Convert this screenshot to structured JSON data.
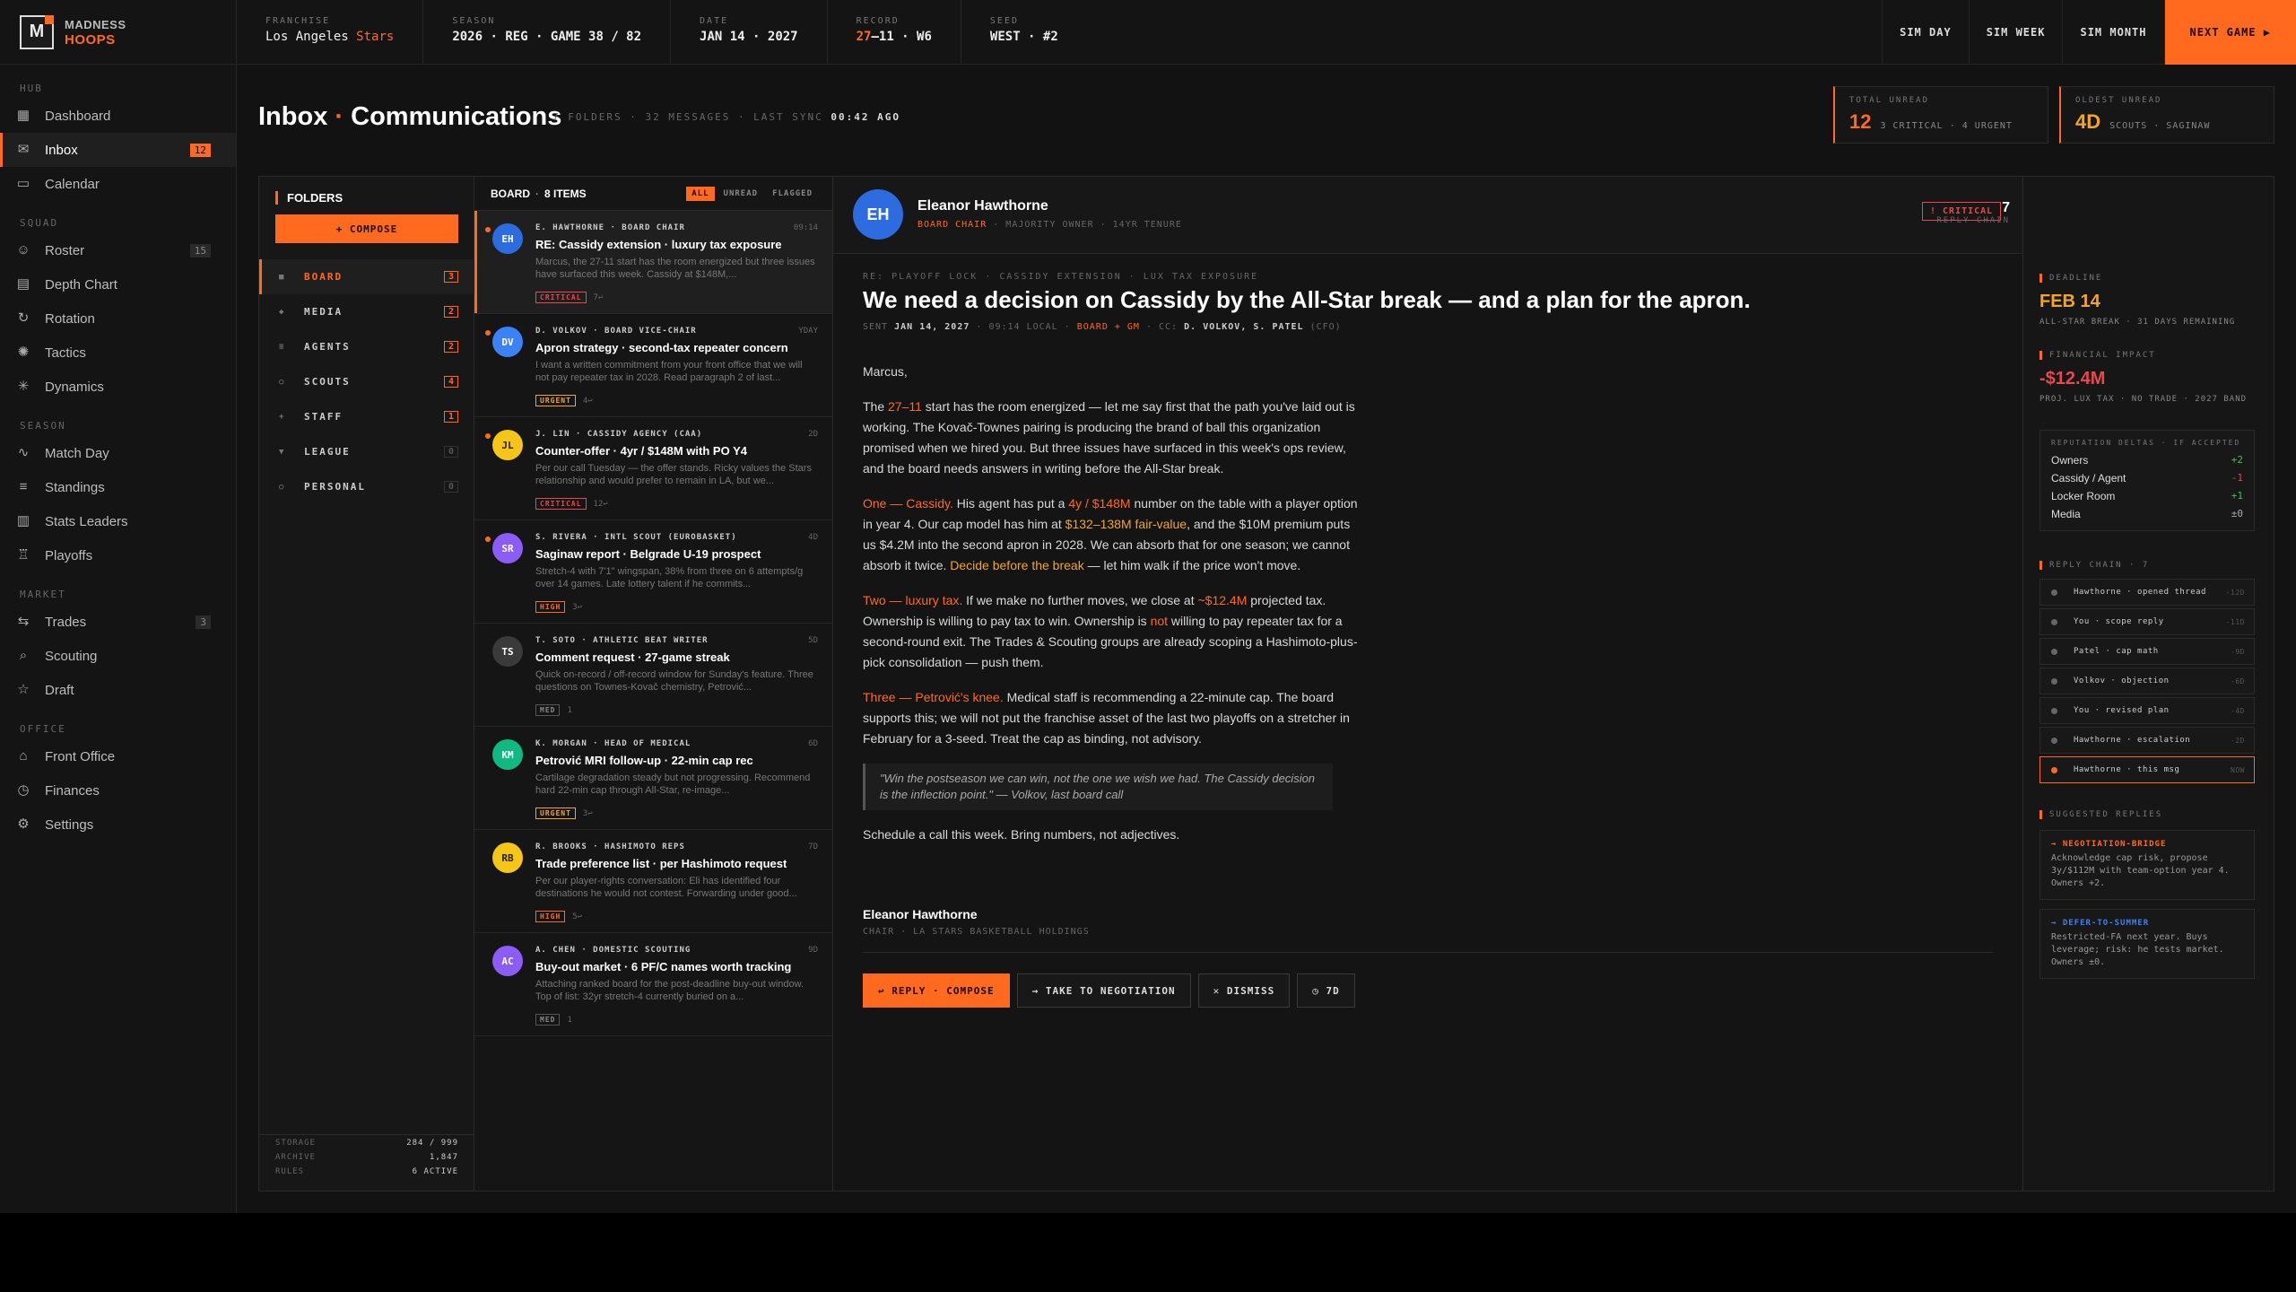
{
  "brand": {
    "line1": "MADNESS",
    "line2": "HOOPS",
    "logo": "M"
  },
  "colors": {
    "accent": "#ff6a1f",
    "warning": "#f5a524",
    "critical": "#e5484d",
    "positive": "#3fbf5f"
  },
  "topbar": {
    "stats": [
      {
        "label": "FRANCHISE",
        "value": "Los Angeles",
        "accent": "Stars"
      },
      {
        "label": "SEASON",
        "value": "2026 · REG · GAME 38 / 82"
      },
      {
        "label": "DATE",
        "value": "JAN 14 · 2027"
      },
      {
        "label": "RECORD",
        "accent": "27",
        "value": "–11 · W6"
      },
      {
        "label": "SEED",
        "value": "WEST · #2"
      }
    ],
    "buttons": [
      "SIM DAY",
      "SIM WEEK",
      "SIM MONTH",
      "NEXT GAME ▶"
    ]
  },
  "sidebar": {
    "sections": [
      {
        "label": "HUB",
        "items": [
          {
            "label": "Dashboard",
            "icon": "grid-icon"
          },
          {
            "label": "Inbox",
            "icon": "mail-icon",
            "count": "12",
            "active": true
          },
          {
            "label": "Calendar",
            "icon": "calendar-icon"
          }
        ]
      },
      {
        "label": "SQUAD",
        "items": [
          {
            "label": "Roster",
            "icon": "user-icon",
            "count": "15"
          },
          {
            "label": "Depth Chart",
            "icon": "layers-icon"
          },
          {
            "label": "Rotation",
            "icon": "rotation-icon"
          },
          {
            "label": "Tactics",
            "icon": "tactics-icon"
          },
          {
            "label": "Dynamics",
            "icon": "dynamics-icon"
          }
        ]
      },
      {
        "label": "SEASON",
        "items": [
          {
            "label": "Match Day",
            "icon": "pulse-icon"
          },
          {
            "label": "Standings",
            "icon": "list-icon"
          },
          {
            "label": "Stats Leaders",
            "icon": "bar-chart-icon"
          },
          {
            "label": "Playoffs",
            "icon": "trophy-icon"
          }
        ]
      },
      {
        "label": "MARKET",
        "items": [
          {
            "label": "Trades",
            "icon": "swap-icon",
            "count": "3"
          },
          {
            "label": "Scouting",
            "icon": "search-icon"
          },
          {
            "label": "Draft",
            "icon": "star-icon"
          }
        ]
      },
      {
        "label": "OFFICE",
        "items": [
          {
            "label": "Front Office",
            "icon": "building-icon"
          },
          {
            "label": "Finances",
            "icon": "clock-icon"
          },
          {
            "label": "Settings",
            "icon": "gear-icon"
          }
        ]
      }
    ]
  },
  "header": {
    "title_a": "Inbox",
    "title_dot": "·",
    "title_b": "Communications",
    "sub": "7 FOLDERS · 32 MESSAGES · LAST SYNC",
    "sync": "00:42 AGO",
    "kpis": [
      {
        "label": "TOTAL UNREAD",
        "value": "12",
        "detail": "3 CRITICAL · 4 URGENT"
      },
      {
        "label": "OLDEST UNREAD",
        "value": "4D",
        "detail": "SCOUTS · SAGINAW"
      }
    ]
  },
  "folders": {
    "title": "FOLDERS",
    "compose": "+ COMPOSE",
    "items": [
      {
        "icon": "■",
        "label": "BOARD",
        "count": "3",
        "active": true
      },
      {
        "icon": "◆",
        "label": "MEDIA",
        "count": "2"
      },
      {
        "icon": "≡",
        "label": "AGENTS",
        "count": "2"
      },
      {
        "icon": "○",
        "label": "SCOUTS",
        "count": "4"
      },
      {
        "icon": "+",
        "label": "STAFF",
        "count": "1"
      },
      {
        "icon": "▼",
        "label": "LEAGUE",
        "count": "0"
      },
      {
        "icon": "○",
        "label": "PERSONAL",
        "count": "0"
      }
    ],
    "stats": [
      {
        "label": "STORAGE",
        "value": "284 / 999"
      },
      {
        "label": "ARCHIVE",
        "value": "1,847"
      },
      {
        "label": "RULES",
        "value": "6 ACTIVE"
      }
    ]
  },
  "list": {
    "folder": "BOARD",
    "count": "8 ITEMS",
    "filters": [
      "ALL",
      "UNREAD",
      "FLAGGED"
    ],
    "messages": [
      {
        "initials": "EH",
        "color": "#2d6cdf",
        "from": "E. HAWTHORNE · BOARD CHAIR",
        "time": "09:14",
        "subject": "RE: Cassidy extension · luxury tax exposure",
        "preview": "Marcus, the 27-11 start has the room energized but three issues have surfaced this week. Cassidy at $148M,...",
        "tag": "CRITICAL",
        "tagType": "crit",
        "replies": "7↩",
        "unread": true,
        "selected": true
      },
      {
        "initials": "DV",
        "color": "#3b82f6",
        "from": "D. VOLKOV · BOARD VICE-CHAIR",
        "time": "YDAY",
        "subject": "Apron strategy · second-tax repeater concern",
        "preview": "I want a written commitment from your front office that we will not pay repeater tax in 2028. Read paragraph 2 of last...",
        "tag": "URGENT",
        "tagType": "urg",
        "replies": "4↩",
        "unread": true
      },
      {
        "initials": "JL",
        "color": "#f5c518",
        "from": "J. LIN · CASSIDY AGENCY (CAA)",
        "time": "2D",
        "subject": "Counter-offer · 4yr / $148M with PO Y4",
        "preview": "Per our call Tuesday — the offer stands. Ricky values the Stars relationship and would prefer to remain in LA, but we...",
        "tag": "CRITICAL",
        "tagType": "crit",
        "replies": "12↩",
        "unread": true
      },
      {
        "initials": "SR",
        "color": "#8b5cf6",
        "from": "S. RIVERA · INTL SCOUT (EUROBASKET)",
        "time": "4D",
        "subject": "Saginaw report · Belgrade U-19 prospect",
        "preview": "Stretch-4 with 7'1\" wingspan, 38% from three on 6 attempts/g over 14 games. Late lottery talent if he commits...",
        "tag": "HIGH",
        "tagType": "high",
        "replies": "3↩",
        "unread": true
      },
      {
        "initials": "TS",
        "color": "#3a3a3a",
        "from": "T. SOTO · ATHLETIC BEAT WRITER",
        "time": "5D",
        "subject": "Comment request · 27-game streak",
        "preview": "Quick on-record / off-record window for Sunday's feature. Three questions on Townes-Kovač chemistry, Petrović...",
        "tag": "MED",
        "tagType": "med",
        "replies": "1"
      },
      {
        "initials": "KM",
        "color": "#10b981",
        "from": "K. MORGAN · HEAD OF MEDICAL",
        "time": "6D",
        "subject": "Petrović MRI follow-up · 22-min cap rec",
        "preview": "Cartilage degradation steady but not progressing. Recommend hard 22-min cap through All-Star, re-image...",
        "tag": "URGENT",
        "tagType": "urg",
        "replies": "3↩"
      },
      {
        "initials": "RB",
        "color": "#f5c518",
        "from": "R. BROOKS · HASHIMOTO REPS",
        "time": "7D",
        "subject": "Trade preference list · per Hashimoto request",
        "preview": "Per our player-rights conversation: Eli has identified four destinations he would not contest. Forwarding under good...",
        "tag": "HIGH",
        "tagType": "high",
        "replies": "5↩"
      },
      {
        "initials": "AC",
        "color": "#8b5cf6",
        "from": "A. CHEN · DOMESTIC SCOUTING",
        "time": "9D",
        "subject": "Buy-out market · 6 PF/C names worth tracking",
        "preview": "Attaching ranked board for the post-deadline buy-out window. Top of list: 32yr stretch-4 currently buried on a...",
        "tag": "MED",
        "tagType": "med",
        "replies": "1"
      }
    ]
  },
  "reader": {
    "initials": "EH",
    "name": "Eleanor Hawthorne",
    "role": "BOARD CHAIR",
    "role_rest": "· MAJORITY OWNER · 14YR TENURE",
    "badge": "! CRITICAL",
    "reply_count": "7",
    "reply_label": "REPLY CHAIN",
    "meta": "RE: PLAYOFF LOCK · CASSIDY EXTENSION · LUX TAX EXPOSURE",
    "subject": "We need a decision on Cassidy by the All-Star break — and a plan for the apron.",
    "sent_label": "SENT",
    "sent_date": "JAN 14, 2027",
    "sent_time": "· 09:14 LOCAL ·",
    "sent_to": "BOARD + GM",
    "cc_label": "· CC:",
    "cc_a": "D. VOLKOV,",
    "cc_b": "S. PATEL",
    "cc_c": "(CFO)",
    "greeting": "Marcus,",
    "p1": {
      "a": "The ",
      "b": "27–11",
      "c": " start has the room energized — let me say first that the path you've laid out is working. The Kovač-Townes pairing is producing the brand of ball this organization promised when we hired you. But three issues have surfaced in this week's ops review, and the board needs answers in writing before the All-Star break."
    },
    "p2": {
      "a": "One — Cassidy.",
      "b": " His agent has put a ",
      "c": "4y / $148M",
      "d": " number on the table with a player option in year 4. Our cap model has him at ",
      "e": "$132–138M fair-value",
      "f": ", and the $10M premium puts us $4.2M into the second apron in 2028. We can absorb that for one season; we cannot absorb it twice. ",
      "g": "Decide before the break",
      "h": " — let him walk if the price won't move."
    },
    "p3": {
      "a": "Two — luxury tax.",
      "b": " If we make no further moves, we close at ",
      "c": "~$12.4M",
      "d": " projected tax. Ownership is willing to pay tax to win. Ownership is ",
      "e": "not",
      "f": " willing to pay repeater tax for a second-round exit. The Trades & Scouting groups are already scoping a Hashimoto-plus-pick consolidation — push them."
    },
    "p4": {
      "a": "Three — Petrović's knee.",
      "b": " Medical staff is recommending a 22-minute cap. The board supports this; we will not put the franchise asset of the last two playoffs on a stretcher in February for a 3-seed. Treat the cap as binding, not advisory."
    },
    "quote": "\"Win the postseason we can win, not the one we wish we had. The Cassidy decision is the inflection point.\" — Volkov, last board call",
    "closing": "Schedule a call this week. Bring numbers, not adjectives.",
    "sig_name": "Eleanor Hawthorne",
    "sig_role": "CHAIR · LA STARS BASKETBALL HOLDINGS",
    "actions": [
      "↩ REPLY · COMPOSE",
      "→ TAKE TO NEGOTIATION",
      "✕ DISMISS",
      "◷ 7D"
    ]
  },
  "aside": {
    "deadline_label": "DEADLINE",
    "deadline": "FEB 14",
    "deadline_sub": "ALL-STAR BREAK · 31 DAYS REMAINING",
    "impact_label": "FINANCIAL IMPACT",
    "impact": "-$12.4M",
    "impact_sub": "PROJ. LUX TAX · NO TRADE · 2027 BAND",
    "rep_label": "REPUTATION DELTAS · IF ACCEPTED",
    "rep": [
      {
        "label": "Owners",
        "value": "+2",
        "type": "pos"
      },
      {
        "label": "Cassidy / Agent",
        "value": "-1",
        "type": "neg"
      },
      {
        "label": "Locker Room",
        "value": "+1",
        "type": "pos"
      },
      {
        "label": "Media",
        "value": "±0",
        "type": "neu"
      }
    ],
    "chain_label": "REPLY CHAIN · 7",
    "chain": [
      {
        "label": "Hawthorne · opened thread",
        "time": "-12D"
      },
      {
        "label": "You · scope reply",
        "time": "-11D"
      },
      {
        "label": "Patel · cap math",
        "time": "-9D"
      },
      {
        "label": "Volkov · objection",
        "time": "-6D"
      },
      {
        "label": "You · revised plan",
        "time": "-4D"
      },
      {
        "label": "Hawthorne · escalation",
        "time": "-2D"
      },
      {
        "label": "Hawthorne · this msg",
        "time": "NOW",
        "current": true
      }
    ],
    "sugg_label": "SUGGESTED REPLIES",
    "sugg": [
      {
        "label": "→ NEGOTIATION-BRIDGE",
        "color": "#ff6a1f",
        "text": "Acknowledge cap risk, propose 3y/$112M with team-option year 4. Owners +2."
      },
      {
        "label": "→ DEFER-TO-SUMMER",
        "color": "#3b82f6",
        "text": "Restricted-FA next year. Buys leverage; risk: he tests market. Owners ±0."
      }
    ]
  }
}
